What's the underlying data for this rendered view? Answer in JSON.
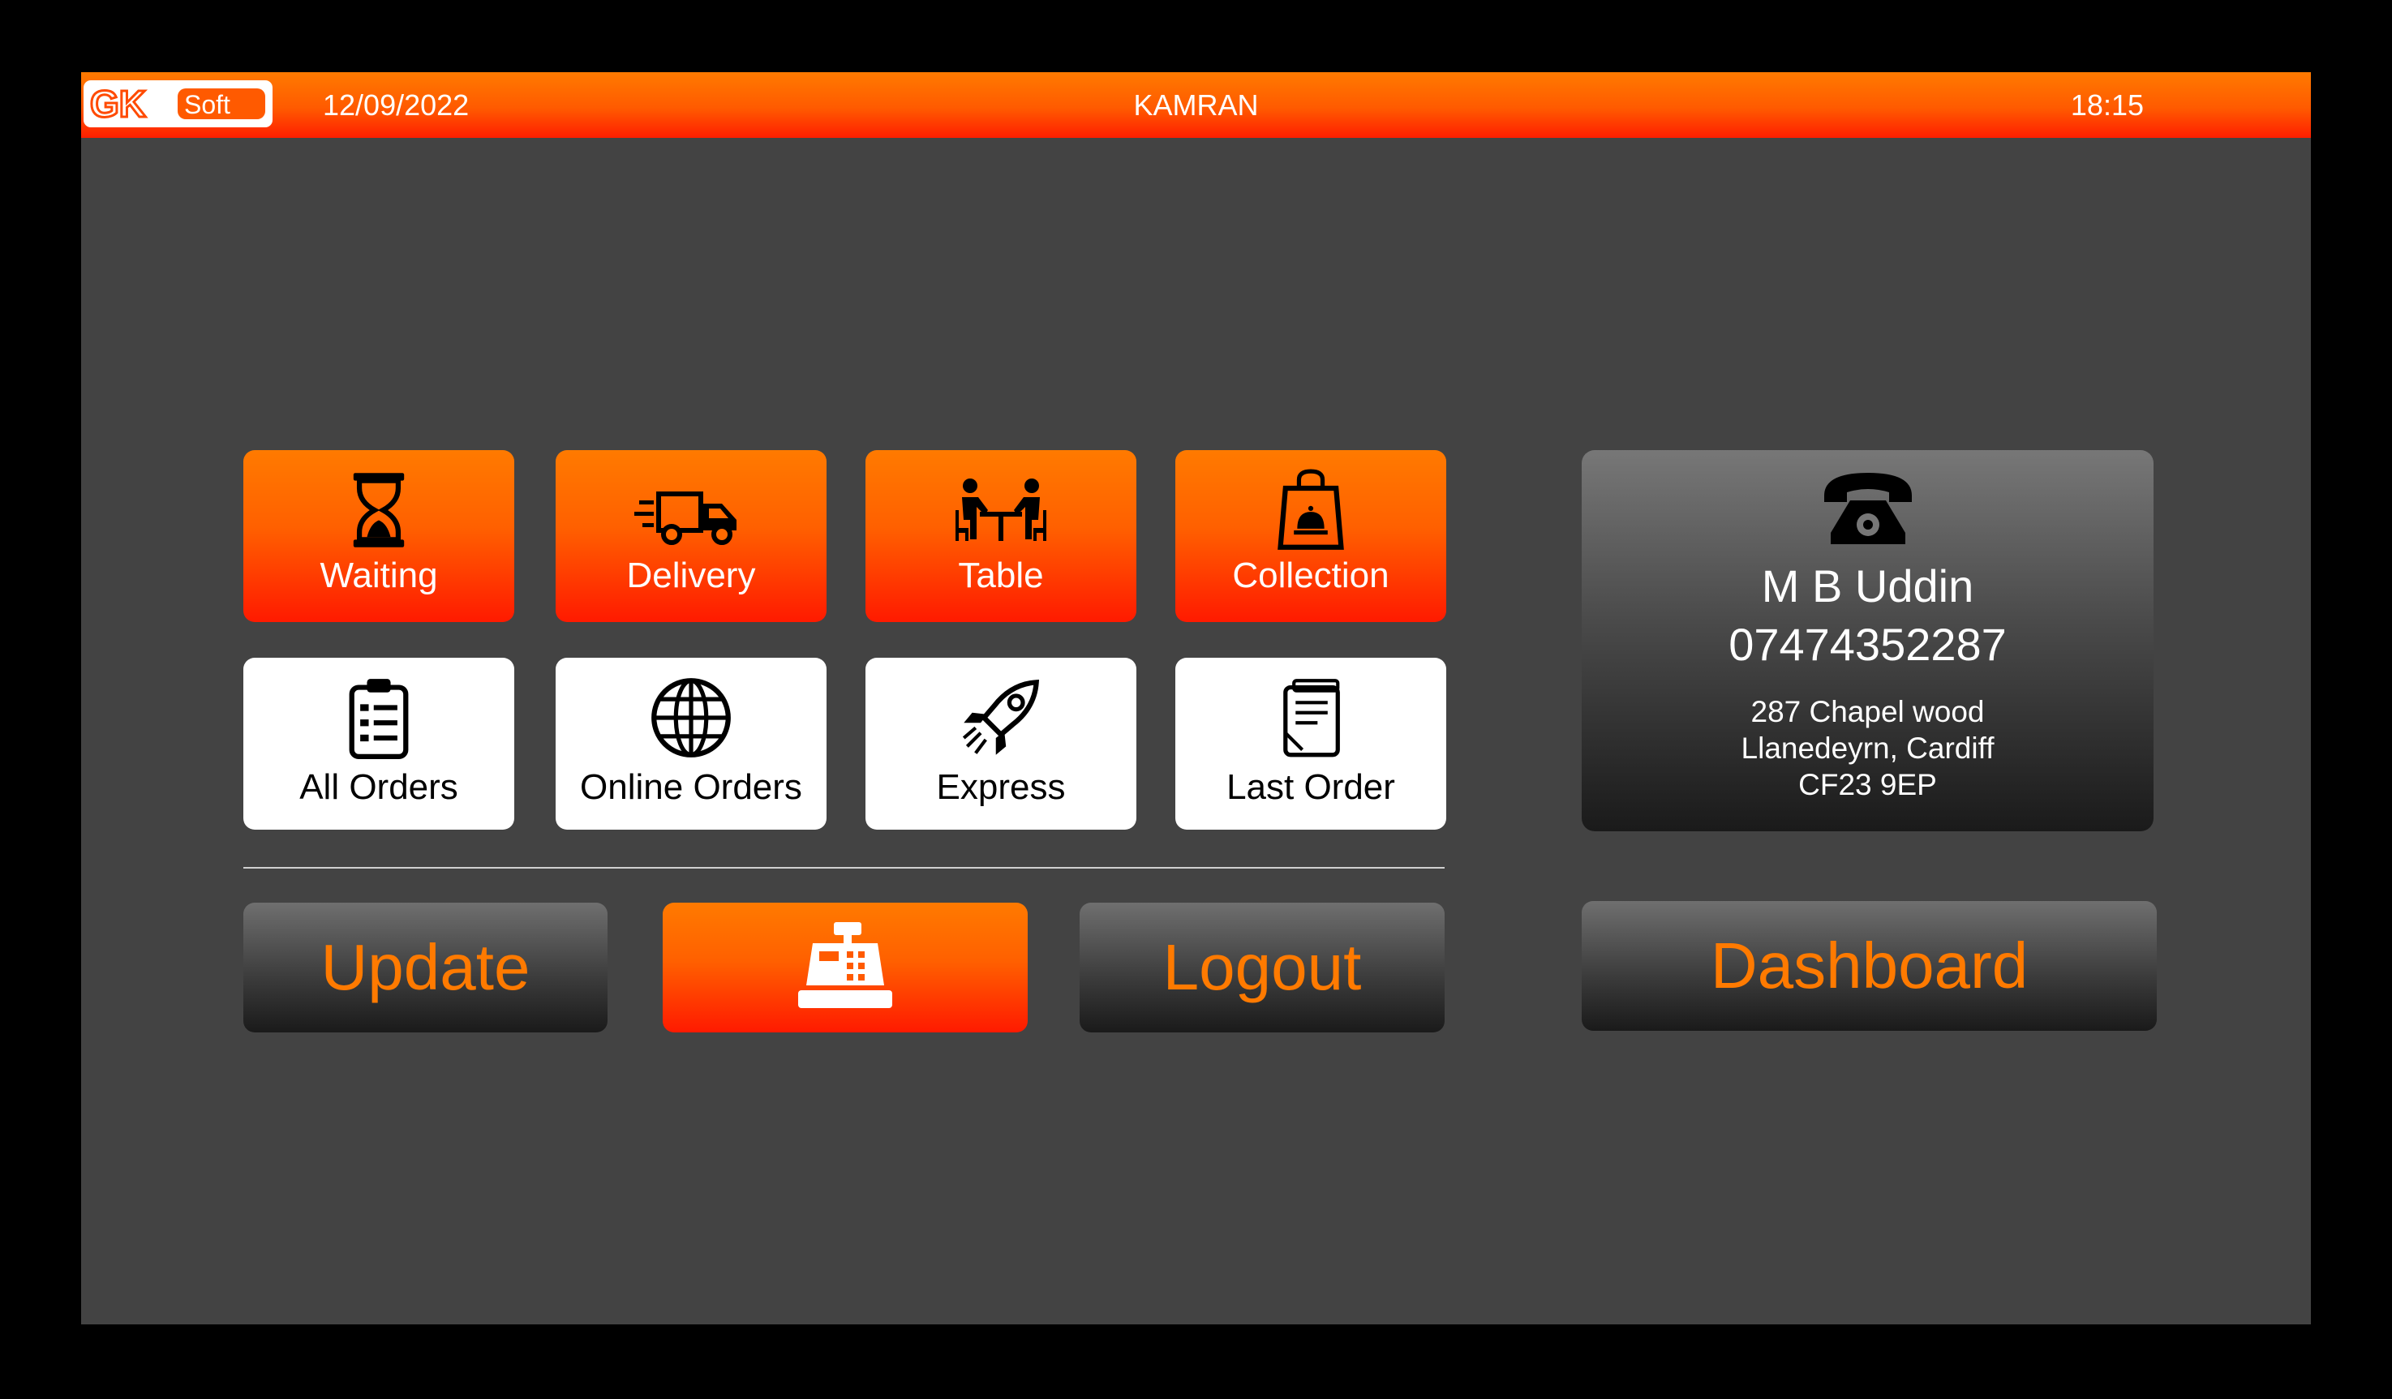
{
  "header": {
    "logo_text": "GKSoft",
    "date": "12/09/2022",
    "user": "KAMRAN",
    "time": "18:15"
  },
  "tiles_primary": [
    {
      "label": "Waiting",
      "icon": "hourglass-icon"
    },
    {
      "label": "Delivery",
      "icon": "delivery-truck-icon"
    },
    {
      "label": "Table",
      "icon": "dining-table-icon"
    },
    {
      "label": "Collection",
      "icon": "shopping-bag-icon"
    }
  ],
  "tiles_secondary": [
    {
      "label": "All Orders",
      "icon": "clipboard-list-icon"
    },
    {
      "label": "Online Orders",
      "icon": "globe-icon"
    },
    {
      "label": "Express",
      "icon": "rocket-icon"
    },
    {
      "label": "Last Order",
      "icon": "receipt-icon"
    }
  ],
  "actions": {
    "update": "Update",
    "till_icon": "cash-register-icon",
    "logout": "Logout",
    "dashboard": "Dashboard"
  },
  "customer": {
    "icon": "telephone-icon",
    "name": "M B Uddin",
    "phone": "07474352287",
    "address": [
      "287 Chapel wood",
      "Llanedeyrn, Cardiff",
      "CF23 9EP"
    ]
  },
  "colors": {
    "accent": "#ff7a00",
    "accent_dark": "#ff1a00",
    "background": "#434343",
    "tile_white": "#ffffff"
  }
}
